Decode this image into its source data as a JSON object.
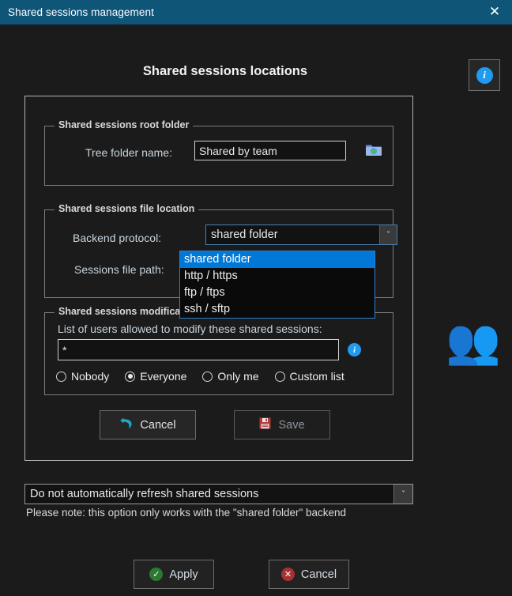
{
  "window": {
    "title": "Shared sessions management",
    "close_label": "✕"
  },
  "header": {
    "page_title": "Shared sessions locations",
    "info_glyph": "i"
  },
  "groups": {
    "root_folder": {
      "legend": "Shared sessions root folder",
      "tree_label": "Tree folder name:",
      "tree_value": "Shared by team",
      "browse_icon": "shared-folder-icon"
    },
    "file_location": {
      "legend": "Shared sessions file location",
      "backend_label": "Backend protocol:",
      "backend_value": "shared folder",
      "path_label": "Sessions file path:",
      "dropdown_options": [
        "shared folder",
        "http / https",
        "ftp / ftps",
        "ssh / sftp"
      ],
      "dropdown_selected_index": 0,
      "arrow_glyph": "ˇ"
    },
    "modification": {
      "legend": "Shared sessions modification",
      "users_label": "List of users allowed to modify these shared sessions:",
      "users_value": "*",
      "info_glyph": "i",
      "radios": [
        {
          "label": "Nobody",
          "checked": false
        },
        {
          "label": "Everyone",
          "checked": true
        },
        {
          "label": "Only me",
          "checked": false
        },
        {
          "label": "Custom list",
          "checked": false
        }
      ]
    }
  },
  "inner_buttons": {
    "cancel_label": "Cancel",
    "save_label": "Save"
  },
  "refresh": {
    "value": "Do not automatically refresh shared sessions",
    "arrow_glyph": "ˇ",
    "note": "Please note: this option only works with the \"shared folder\" backend"
  },
  "bottom_buttons": {
    "apply_label": "Apply",
    "apply_glyph": "✓",
    "cancel_label": "Cancel",
    "cancel_glyph": "✕"
  },
  "decoration": {
    "people_glyph": "👥"
  },
  "colors": {
    "titlebar": "#0e5578",
    "background": "#1b1b1b",
    "accent_blue": "#0078d7",
    "info_blue": "#1f9cf0",
    "apply_green": "#2c7a32",
    "cancel_red": "#a63131",
    "undo_cyan": "#19a8c8"
  }
}
